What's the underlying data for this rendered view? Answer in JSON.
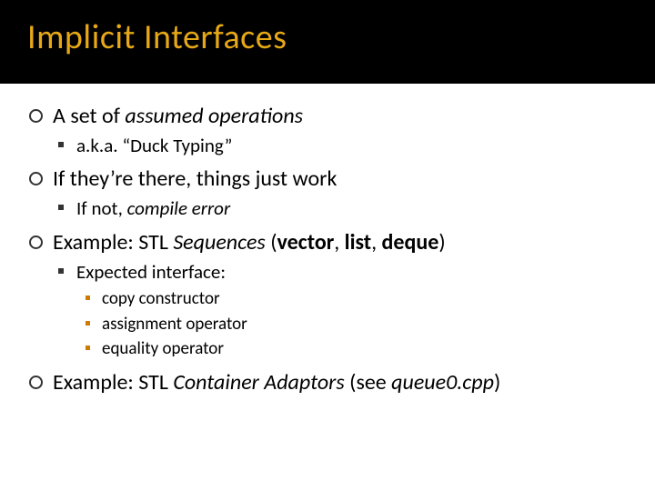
{
  "title": "Implicit Interfaces",
  "l1_0_a": "A set of ",
  "l1_0_b": "assumed operations",
  "l1_0_sub_0": "a.k.a. “Duck Typing”",
  "l1_1": "If they’re there, things just work",
  "l1_1_sub_0_a": "If not, ",
  "l1_1_sub_0_b": "compile error",
  "l1_2_a": "Example: STL ",
  "l1_2_b": "Sequences",
  "l1_2_c": " (",
  "l1_2_d": "vector",
  "l1_2_e": ", ",
  "l1_2_f": "list",
  "l1_2_g": ", ",
  "l1_2_h": "deque",
  "l1_2_i": ")",
  "l1_2_sub_0": "Expected interface:",
  "l1_2_sub_0_sub_0": "copy constructor",
  "l1_2_sub_0_sub_1": "assignment operator",
  "l1_2_sub_0_sub_2": "equality operator",
  "l1_3_a": "Example: STL ",
  "l1_3_b": "Container Adaptors",
  "l1_3_c": " (see ",
  "l1_3_d": "queue0.cpp",
  "l1_3_e": ")"
}
